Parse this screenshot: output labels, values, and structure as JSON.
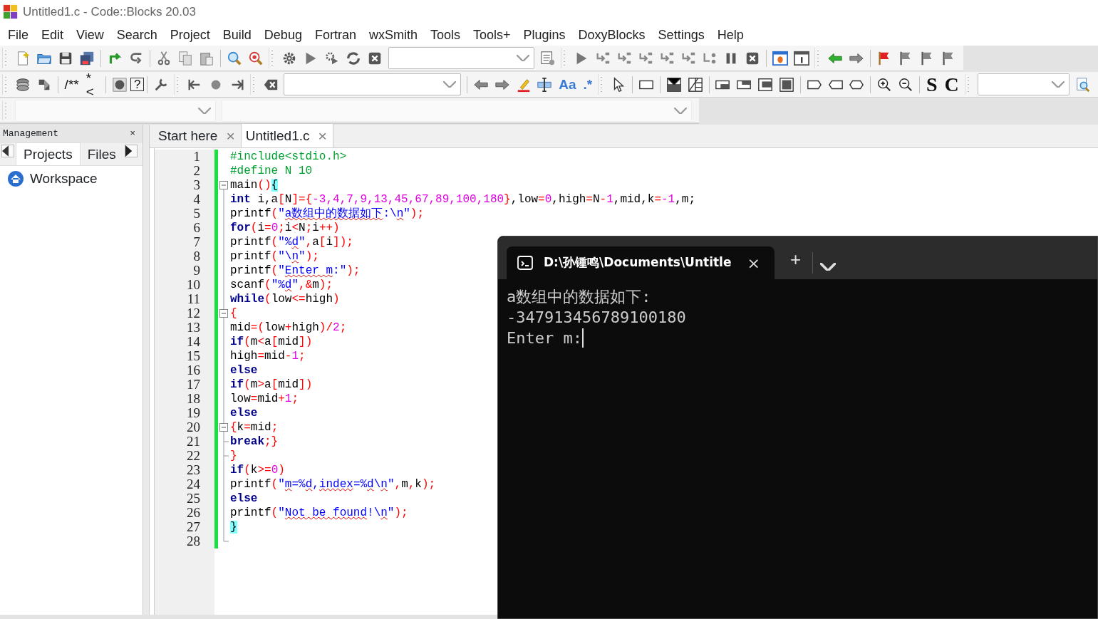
{
  "window": {
    "title": "Untitled1.c - Code::Blocks 20.03"
  },
  "menu": [
    "File",
    "Edit",
    "View",
    "Search",
    "Project",
    "Build",
    "Debug",
    "Fortran",
    "wxSmith",
    "Tools",
    "Tools+",
    "Plugins",
    "DoxyBlocks",
    "Settings",
    "Help"
  ],
  "toolbar_texts": [
    "/**",
    "*<",
    "?",
    "Aa",
    ".*",
    "S",
    "C"
  ],
  "management": {
    "title": "Management",
    "close": "×",
    "tabs": [
      {
        "label": "Projects",
        "selected": true
      },
      {
        "label": "Files",
        "selected": false
      }
    ],
    "tree": [
      {
        "label": "Workspace"
      }
    ]
  },
  "editor_tabs": [
    {
      "label": "Start here",
      "close": "×",
      "selected": false
    },
    {
      "label": "Untitled1.c",
      "close": "×",
      "selected": true
    }
  ],
  "code": {
    "lines": [
      {
        "number": "1",
        "fold_start": false,
        "fold_end": false,
        "in_fold": false,
        "tokens": [
          {
            "kind": "pp",
            "text": "#include<stdio.h>"
          }
        ]
      },
      {
        "number": "2",
        "fold_start": false,
        "fold_end": false,
        "in_fold": false,
        "tokens": [
          {
            "kind": "pp",
            "text": "#define N 10"
          }
        ]
      },
      {
        "number": "3",
        "fold_start": true,
        "fold_end": false,
        "in_fold": false,
        "tokens": [
          {
            "kind": "id",
            "text": "main"
          },
          {
            "kind": "op",
            "text": "()"
          },
          {
            "kind": "bm",
            "text": "{"
          }
        ]
      },
      {
        "number": "4",
        "fold_start": false,
        "fold_end": false,
        "in_fold": true,
        "tokens": [
          {
            "kind": "kw",
            "text": "int"
          },
          {
            "kind": "id",
            "text": " i,a"
          },
          {
            "kind": "op",
            "text": "["
          },
          {
            "kind": "id",
            "text": "N"
          },
          {
            "kind": "op",
            "text": "]={"
          },
          {
            "kind": "num",
            "text": "-3,4,7,9,13,45,67,89,100,180"
          },
          {
            "kind": "op",
            "text": "}"
          },
          {
            "kind": "id",
            "text": ",low"
          },
          {
            "kind": "op",
            "text": "="
          },
          {
            "kind": "num",
            "text": "0"
          },
          {
            "kind": "id",
            "text": ",high"
          },
          {
            "kind": "op",
            "text": "="
          },
          {
            "kind": "id",
            "text": "N"
          },
          {
            "kind": "op",
            "text": "-"
          },
          {
            "kind": "num",
            "text": "1"
          },
          {
            "kind": "id",
            "text": ",mid,k"
          },
          {
            "kind": "op",
            "text": "="
          },
          {
            "kind": "num",
            "text": "-1"
          },
          {
            "kind": "id",
            "text": ",m;"
          }
        ]
      },
      {
        "number": "5",
        "fold_start": false,
        "fold_end": false,
        "in_fold": true,
        "tokens": [
          {
            "kind": "id",
            "text": "printf"
          },
          {
            "kind": "op",
            "text": "("
          },
          {
            "kind": "str",
            "text": "\""
          },
          {
            "kind": "spell",
            "text": "a数组中的数据如下"
          },
          {
            "kind": "str",
            "text": ":\\"
          },
          {
            "kind": "spell",
            "text": "n"
          },
          {
            "kind": "str",
            "text": "\""
          },
          {
            "kind": "op",
            "text": ");"
          }
        ]
      },
      {
        "number": "6",
        "fold_start": false,
        "fold_end": false,
        "in_fold": true,
        "tokens": [
          {
            "kind": "kw",
            "text": "for"
          },
          {
            "kind": "op",
            "text": "("
          },
          {
            "kind": "id",
            "text": "i"
          },
          {
            "kind": "op",
            "text": "="
          },
          {
            "kind": "num",
            "text": "0"
          },
          {
            "kind": "op",
            "text": ";"
          },
          {
            "kind": "id",
            "text": "i"
          },
          {
            "kind": "op",
            "text": "<"
          },
          {
            "kind": "id",
            "text": "N"
          },
          {
            "kind": "op",
            "text": ";"
          },
          {
            "kind": "id",
            "text": "i"
          },
          {
            "kind": "op",
            "text": "++)"
          }
        ]
      },
      {
        "number": "7",
        "fold_start": false,
        "fold_end": false,
        "in_fold": true,
        "tokens": [
          {
            "kind": "id",
            "text": "printf"
          },
          {
            "kind": "op",
            "text": "("
          },
          {
            "kind": "str",
            "text": "\"%"
          },
          {
            "kind": "spell",
            "text": "d"
          },
          {
            "kind": "str",
            "text": "\""
          },
          {
            "kind": "op",
            "text": ","
          },
          {
            "kind": "id",
            "text": "a"
          },
          {
            "kind": "op",
            "text": "["
          },
          {
            "kind": "id",
            "text": "i"
          },
          {
            "kind": "op",
            "text": "]);"
          }
        ]
      },
      {
        "number": "8",
        "fold_start": false,
        "fold_end": false,
        "in_fold": true,
        "tokens": [
          {
            "kind": "id",
            "text": "printf"
          },
          {
            "kind": "op",
            "text": "("
          },
          {
            "kind": "str",
            "text": "\"\\"
          },
          {
            "kind": "spell",
            "text": "n"
          },
          {
            "kind": "str",
            "text": "\""
          },
          {
            "kind": "op",
            "text": ");"
          }
        ]
      },
      {
        "number": "9",
        "fold_start": false,
        "fold_end": false,
        "in_fold": true,
        "tokens": [
          {
            "kind": "id",
            "text": "printf"
          },
          {
            "kind": "op",
            "text": "("
          },
          {
            "kind": "str",
            "text": "\""
          },
          {
            "kind": "spell",
            "text": "Enter m"
          },
          {
            "kind": "str",
            "text": ":\""
          },
          {
            "kind": "op",
            "text": ");"
          }
        ]
      },
      {
        "number": "10",
        "fold_start": false,
        "fold_end": false,
        "in_fold": true,
        "tokens": [
          {
            "kind": "id",
            "text": "scanf"
          },
          {
            "kind": "op",
            "text": "("
          },
          {
            "kind": "str",
            "text": "\"%"
          },
          {
            "kind": "spell",
            "text": "d"
          },
          {
            "kind": "str",
            "text": "\""
          },
          {
            "kind": "op",
            "text": ",&"
          },
          {
            "kind": "id",
            "text": "m"
          },
          {
            "kind": "op",
            "text": ");"
          }
        ]
      },
      {
        "number": "11",
        "fold_start": false,
        "fold_end": false,
        "in_fold": true,
        "tokens": [
          {
            "kind": "kw",
            "text": "while"
          },
          {
            "kind": "op",
            "text": "("
          },
          {
            "kind": "id",
            "text": "low"
          },
          {
            "kind": "op",
            "text": "<="
          },
          {
            "kind": "id",
            "text": "high"
          },
          {
            "kind": "op",
            "text": ")"
          }
        ]
      },
      {
        "number": "12",
        "fold_start": true,
        "fold_end": false,
        "in_fold": true,
        "tokens": [
          {
            "kind": "op",
            "text": "{"
          }
        ]
      },
      {
        "number": "13",
        "fold_start": false,
        "fold_end": false,
        "in_fold": true,
        "tokens": [
          {
            "kind": "id",
            "text": "mid"
          },
          {
            "kind": "op",
            "text": "=("
          },
          {
            "kind": "id",
            "text": "low"
          },
          {
            "kind": "op",
            "text": "+"
          },
          {
            "kind": "id",
            "text": "high"
          },
          {
            "kind": "op",
            "text": ")/"
          },
          {
            "kind": "num",
            "text": "2"
          },
          {
            "kind": "op",
            "text": ";"
          }
        ]
      },
      {
        "number": "14",
        "fold_start": false,
        "fold_end": false,
        "in_fold": true,
        "tokens": [
          {
            "kind": "kw",
            "text": "if"
          },
          {
            "kind": "op",
            "text": "("
          },
          {
            "kind": "id",
            "text": "m"
          },
          {
            "kind": "op",
            "text": "<"
          },
          {
            "kind": "id",
            "text": "a"
          },
          {
            "kind": "op",
            "text": "["
          },
          {
            "kind": "id",
            "text": "mid"
          },
          {
            "kind": "op",
            "text": "])"
          }
        ]
      },
      {
        "number": "15",
        "fold_start": false,
        "fold_end": false,
        "in_fold": true,
        "tokens": [
          {
            "kind": "id",
            "text": "high"
          },
          {
            "kind": "op",
            "text": "="
          },
          {
            "kind": "id",
            "text": "mid"
          },
          {
            "kind": "op",
            "text": "-"
          },
          {
            "kind": "num",
            "text": "1"
          },
          {
            "kind": "op",
            "text": ";"
          }
        ]
      },
      {
        "number": "16",
        "fold_start": false,
        "fold_end": false,
        "in_fold": true,
        "tokens": [
          {
            "kind": "kw",
            "text": "else"
          }
        ]
      },
      {
        "number": "17",
        "fold_start": false,
        "fold_end": false,
        "in_fold": true,
        "tokens": [
          {
            "kind": "kw",
            "text": "if"
          },
          {
            "kind": "op",
            "text": "("
          },
          {
            "kind": "id",
            "text": "m"
          },
          {
            "kind": "op",
            "text": ">"
          },
          {
            "kind": "id",
            "text": "a"
          },
          {
            "kind": "op",
            "text": "["
          },
          {
            "kind": "id",
            "text": "mid"
          },
          {
            "kind": "op",
            "text": "])"
          }
        ]
      },
      {
        "number": "18",
        "fold_start": false,
        "fold_end": false,
        "in_fold": true,
        "tokens": [
          {
            "kind": "id",
            "text": "low"
          },
          {
            "kind": "op",
            "text": "="
          },
          {
            "kind": "id",
            "text": "mid"
          },
          {
            "kind": "op",
            "text": "+"
          },
          {
            "kind": "num",
            "text": "1"
          },
          {
            "kind": "op",
            "text": ";"
          }
        ]
      },
      {
        "number": "19",
        "fold_start": false,
        "fold_end": false,
        "in_fold": true,
        "tokens": [
          {
            "kind": "kw",
            "text": "else"
          }
        ]
      },
      {
        "number": "20",
        "fold_start": true,
        "fold_end": false,
        "in_fold": true,
        "tokens": [
          {
            "kind": "op",
            "text": "{"
          },
          {
            "kind": "id",
            "text": "k"
          },
          {
            "kind": "op",
            "text": "="
          },
          {
            "kind": "id",
            "text": "mid"
          },
          {
            "kind": "op",
            "text": ";"
          }
        ]
      },
      {
        "number": "21",
        "fold_start": false,
        "fold_end": true,
        "in_fold": true,
        "tokens": [
          {
            "kind": "kw",
            "text": "break"
          },
          {
            "kind": "op",
            "text": ";}"
          }
        ]
      },
      {
        "number": "22",
        "fold_start": false,
        "fold_end": true,
        "in_fold": true,
        "tokens": [
          {
            "kind": "op",
            "text": "}"
          }
        ]
      },
      {
        "number": "23",
        "fold_start": false,
        "fold_end": false,
        "in_fold": true,
        "tokens": [
          {
            "kind": "kw",
            "text": "if"
          },
          {
            "kind": "op",
            "text": "("
          },
          {
            "kind": "id",
            "text": "k"
          },
          {
            "kind": "op",
            "text": ">="
          },
          {
            "kind": "num",
            "text": "0"
          },
          {
            "kind": "op",
            "text": ")"
          }
        ]
      },
      {
        "number": "24",
        "fold_start": false,
        "fold_end": false,
        "in_fold": true,
        "tokens": [
          {
            "kind": "id",
            "text": "printf"
          },
          {
            "kind": "op",
            "text": "("
          },
          {
            "kind": "str",
            "text": "\""
          },
          {
            "kind": "spell",
            "text": "m"
          },
          {
            "kind": "str",
            "text": "=%"
          },
          {
            "kind": "spell",
            "text": "d"
          },
          {
            "kind": "str",
            "text": ","
          },
          {
            "kind": "spell",
            "text": "index"
          },
          {
            "kind": "str",
            "text": "=%"
          },
          {
            "kind": "spell",
            "text": "d"
          },
          {
            "kind": "str",
            "text": "\\"
          },
          {
            "kind": "spell",
            "text": "n"
          },
          {
            "kind": "str",
            "text": "\""
          },
          {
            "kind": "op",
            "text": ","
          },
          {
            "kind": "id",
            "text": "m"
          },
          {
            "kind": "op",
            "text": ","
          },
          {
            "kind": "id",
            "text": "k"
          },
          {
            "kind": "op",
            "text": ");"
          }
        ]
      },
      {
        "number": "25",
        "fold_start": false,
        "fold_end": false,
        "in_fold": true,
        "tokens": [
          {
            "kind": "kw",
            "text": "else"
          }
        ]
      },
      {
        "number": "26",
        "fold_start": false,
        "fold_end": false,
        "in_fold": true,
        "tokens": [
          {
            "kind": "id",
            "text": "printf"
          },
          {
            "kind": "op",
            "text": "("
          },
          {
            "kind": "str",
            "text": "\""
          },
          {
            "kind": "spell",
            "text": "Not be found"
          },
          {
            "kind": "str",
            "text": "!\\"
          },
          {
            "kind": "spell",
            "text": "n"
          },
          {
            "kind": "str",
            "text": "\""
          },
          {
            "kind": "op",
            "text": ");"
          }
        ]
      },
      {
        "number": "27",
        "fold_start": false,
        "fold_end": false,
        "in_fold": true,
        "tokens": [
          {
            "kind": "bm",
            "text": "}"
          }
        ]
      },
      {
        "number": "28",
        "fold_start": false,
        "fold_end": true,
        "in_fold": true
      }
    ]
  },
  "terminal": {
    "tab_title": "D:\\孙锺鸣\\Documents\\Untitle",
    "tab_close": "×",
    "new_tab": "+",
    "lines": [
      "a数组中的数据如下:",
      "-347913456789100180",
      "Enter m:"
    ],
    "cursor": true
  }
}
